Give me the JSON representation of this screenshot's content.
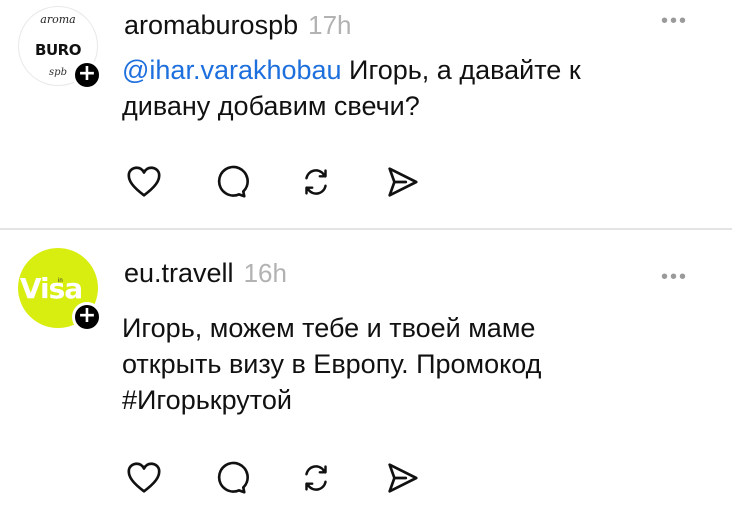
{
  "posts": [
    {
      "username": "aromaburospb",
      "time": "17h",
      "mention": "@ihar.varakhobau",
      "text_line1": " Игорь, а давайте к",
      "text_line2": "дивану добавим свечи?",
      "avatar": {
        "top": "aroma",
        "middle": "BURO",
        "bottom": "spb"
      },
      "follow_icon": "+",
      "more_icon": "•••"
    },
    {
      "username": "eu.travell",
      "time": "16h",
      "text_line1": "Игорь, можем тебе и твоей маме",
      "text_line2": "открыть визу в Европу. Промокод",
      "text_line3": "#Игорькрутой",
      "avatar": {
        "main": "Visa",
        "sub": "in"
      },
      "follow_icon": "+",
      "more_icon": "•••"
    }
  ],
  "icons": [
    "heart-icon",
    "comment-icon",
    "repost-icon",
    "share-icon"
  ],
  "colors": {
    "mention": "#1e6fde",
    "time": "#b2b2b2",
    "visa_avatar": "#d8ee10"
  }
}
